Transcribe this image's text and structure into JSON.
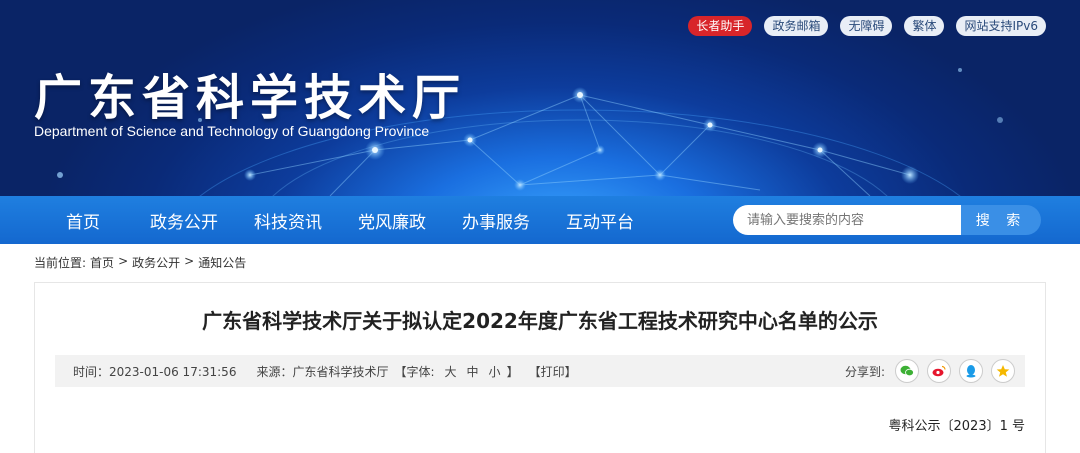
{
  "header": {
    "site_title": "广东省科学技术厅",
    "site_subtitle": "Department of Science and Technology of Guangdong Province",
    "tools": [
      "长者助手",
      "政务邮箱",
      "无障碍",
      "繁体",
      "网站支持IPv6"
    ]
  },
  "nav": {
    "items": [
      "首页",
      "政务公开",
      "科技资讯",
      "党风廉政",
      "办事服务",
      "互动平台"
    ],
    "search_placeholder": "请输入要搜索的内容",
    "search_button": "搜 索"
  },
  "breadcrumb": {
    "label": "当前位置:",
    "items": [
      "首页",
      "政务公开",
      "通知公告"
    ],
    "separator": ">"
  },
  "article": {
    "title": "广东省科学技术厅关于拟认定2022年度广东省工程技术研究中心名单的公示",
    "time": "时间：2023-01-06 17:31:56",
    "source": "来源：广东省科学技术厅",
    "fontsize_label": "【字体:",
    "fontsize_large": "大",
    "fontsize_medium": "中",
    "fontsize_small": "小",
    "fontsize_close": "】",
    "print": "【打印】",
    "share_label": "分享到:",
    "doc_number": "粤科公示〔2023〕1 号"
  },
  "colors": {
    "nav_blue": "#1a74db",
    "accent_red": "#d8252a",
    "banner_dark": "#0a2a78"
  },
  "icons": {
    "share": [
      "wechat-icon",
      "weibo-icon",
      "qq-icon",
      "qzone-icon"
    ]
  }
}
